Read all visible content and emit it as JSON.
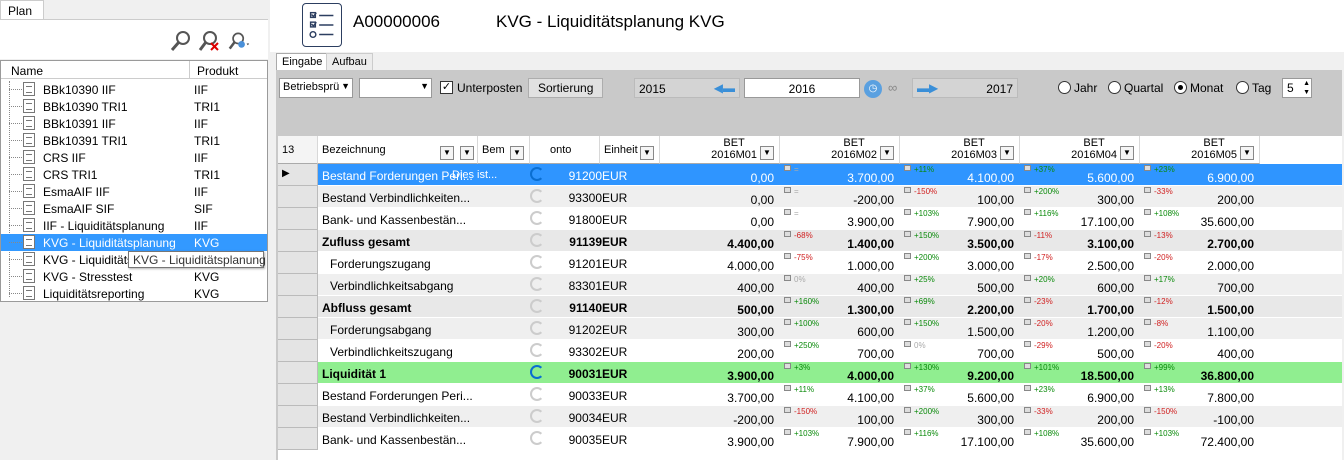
{
  "left_panel": {
    "tab_label": "Plan",
    "columns": {
      "name": "Name",
      "product": "Produkt"
    },
    "items": [
      {
        "name": "BBk10390 IIF",
        "product": "IIF"
      },
      {
        "name": "BBk10390 TRI1",
        "product": "TRI1"
      },
      {
        "name": "BBk10391 IIF",
        "product": "IIF"
      },
      {
        "name": "BBk10391 TRI1",
        "product": "TRI1"
      },
      {
        "name": "CRS IIF",
        "product": "IIF"
      },
      {
        "name": "CRS TRI1",
        "product": "TRI1"
      },
      {
        "name": "EsmaAIF IIF",
        "product": "IIF"
      },
      {
        "name": "EsmaAIF SIF",
        "product": "SIF"
      },
      {
        "name": "IIF - Liquiditätsplanung",
        "product": "IIF"
      },
      {
        "name": "KVG - Liquiditätsplanung",
        "product": "KVG"
      },
      {
        "name": "KVG - Liquiditätsp",
        "product": "KVG"
      },
      {
        "name": "KVG - Stresstest",
        "product": "KVG"
      },
      {
        "name": "Liquiditätsreporting",
        "product": "KVG"
      }
    ],
    "tooltip": "KVG - Liquiditätsplanung"
  },
  "header": {
    "id": "A00000006",
    "title": "KVG - Liquiditätsplanung KVG",
    "collapse_glyph": "<"
  },
  "tabs": [
    "Eingabe",
    "Aufbau"
  ],
  "controls": {
    "dropdown1": "Betriebsprü",
    "dropdown2": "",
    "checkbox_label": "Unterposten",
    "checkbox_checked": true,
    "sort_button": "Sortierung",
    "year_prev": "2015",
    "year_current": "2016",
    "year_next": "2017",
    "radios": [
      "Jahr",
      "Quartal",
      "Monat",
      "Tag"
    ],
    "radio_selected": "Monat",
    "spinner_value": "5"
  },
  "grid": {
    "corner": "13",
    "col_bezeichnung": "Bezeichnung",
    "col_bem": "Bem",
    "col_konto": "onto",
    "col_einheit": "Einheit",
    "months": [
      {
        "l1": "BET",
        "l2": "2016M01"
      },
      {
        "l1": "BET",
        "l2": "2016M02"
      },
      {
        "l1": "BET",
        "l2": "2016M03"
      },
      {
        "l1": "BET",
        "l2": "2016M04"
      },
      {
        "l1": "BET",
        "l2": "2016M05"
      }
    ],
    "rows": [
      {
        "style": "blue",
        "indent": 0,
        "label": "Bestand Forderungen Peri...",
        "bem": "Dies ist...",
        "konto": "91200",
        "einheit": "EUR",
        "values": [
          "0,00",
          "3.700,00",
          "4.100,00",
          "5.600,00",
          "6.900,00"
        ],
        "pct": [
          "",
          "=",
          "+11%",
          "+37%",
          "+23%"
        ]
      },
      {
        "style": "alt",
        "indent": 0,
        "label": "Bestand Verbindlichkeiten...",
        "bem": "",
        "konto": "93300",
        "einheit": "EUR",
        "values": [
          "0,00",
          "-200,00",
          "100,00",
          "300,00",
          "200,00"
        ],
        "pct": [
          "",
          "=",
          "-150%",
          "+200%",
          "-33%"
        ]
      },
      {
        "style": "",
        "indent": 0,
        "label": "Bank- und Kassenbestän...",
        "bem": "",
        "konto": "91800",
        "einheit": "EUR",
        "values": [
          "0,00",
          "3.900,00",
          "7.900,00",
          "17.100,00",
          "35.600,00"
        ],
        "pct": [
          "",
          "=",
          "+103%",
          "+116%",
          "+108%"
        ]
      },
      {
        "style": "bold",
        "indent": 0,
        "label": "Zufluss gesamt",
        "bem": "",
        "konto": "91139",
        "einheit": "EUR",
        "values": [
          "4.400,00",
          "1.400,00",
          "3.500,00",
          "3.100,00",
          "2.700,00"
        ],
        "pct": [
          "",
          "-68%",
          "+150%",
          "-11%",
          "-13%"
        ]
      },
      {
        "style": "",
        "indent": 1,
        "label": "Forderungszugang",
        "bem": "",
        "konto": "91201",
        "einheit": "EUR",
        "values": [
          "4.000,00",
          "1.000,00",
          "3.000,00",
          "2.500,00",
          "2.000,00"
        ],
        "pct": [
          "",
          "-75%",
          "+200%",
          "-17%",
          "-20%"
        ]
      },
      {
        "style": "alt",
        "indent": 1,
        "label": "Verbindlichkeitsabgang",
        "bem": "",
        "konto": "83301",
        "einheit": "EUR",
        "values": [
          "400,00",
          "400,00",
          "500,00",
          "600,00",
          "700,00"
        ],
        "pct": [
          "",
          "0%",
          "+25%",
          "+20%",
          "+17%"
        ]
      },
      {
        "style": "bold",
        "indent": 0,
        "label": "Abfluss gesamt",
        "bem": "",
        "konto": "91140",
        "einheit": "EUR",
        "values": [
          "500,00",
          "1.300,00",
          "2.200,00",
          "1.700,00",
          "1.500,00"
        ],
        "pct": [
          "",
          "+160%",
          "+69%",
          "-23%",
          "-12%"
        ]
      },
      {
        "style": "alt",
        "indent": 1,
        "label": "Forderungsabgang",
        "bem": "",
        "konto": "91202",
        "einheit": "EUR",
        "values": [
          "300,00",
          "600,00",
          "1.500,00",
          "1.200,00",
          "1.100,00"
        ],
        "pct": [
          "",
          "+100%",
          "+150%",
          "-20%",
          "-8%"
        ]
      },
      {
        "style": "",
        "indent": 1,
        "label": "Verbindlichkeitszugang",
        "bem": "",
        "konto": "93302",
        "einheit": "EUR",
        "values": [
          "200,00",
          "700,00",
          "700,00",
          "500,00",
          "400,00"
        ],
        "pct": [
          "",
          "+250%",
          "0%",
          "-29%",
          "-20%"
        ]
      },
      {
        "style": "green",
        "indent": 0,
        "label": "Liquidität 1",
        "bem": "",
        "konto": "90031",
        "einheit": "EUR",
        "values": [
          "3.900,00",
          "4.000,00",
          "9.200,00",
          "18.500,00",
          "36.800,00"
        ],
        "pct": [
          "",
          "+3%",
          "+130%",
          "+101%",
          "+99%"
        ]
      },
      {
        "style": "",
        "indent": 0,
        "label": "Bestand Forderungen Peri...",
        "bem": "",
        "konto": "90033",
        "einheit": "EUR",
        "values": [
          "3.700,00",
          "4.100,00",
          "5.600,00",
          "6.900,00",
          "7.800,00"
        ],
        "pct": [
          "",
          "+11%",
          "+37%",
          "+23%",
          "+13%"
        ]
      },
      {
        "style": "alt",
        "indent": 0,
        "label": "Bestand Verbindlichkeiten...",
        "bem": "",
        "konto": "90034",
        "einheit": "EUR",
        "values": [
          "-200,00",
          "100,00",
          "300,00",
          "200,00",
          "-100,00"
        ],
        "pct": [
          "",
          "-150%",
          "+200%",
          "-33%",
          "-150%"
        ]
      },
      {
        "style": "",
        "indent": 0,
        "label": "Bank- und Kassenbestän...",
        "bem": "",
        "konto": "90035",
        "einheit": "EUR",
        "values": [
          "3.900,00",
          "7.900,00",
          "17.100,00",
          "35.600,00",
          "72.400,00"
        ],
        "pct": [
          "",
          "+103%",
          "+116%",
          "+108%",
          "+103%"
        ]
      }
    ]
  }
}
